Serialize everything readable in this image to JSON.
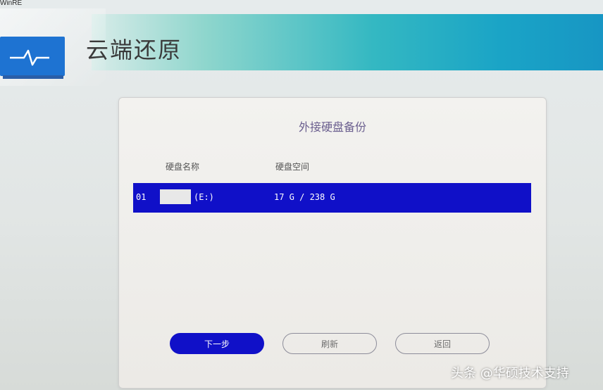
{
  "window": {
    "title": "WinRE"
  },
  "header": {
    "title": "云端还原"
  },
  "dialog": {
    "title": "外接硬盘备份",
    "columns": {
      "name": "硬盘名称",
      "space": "硬盘空间"
    },
    "rows": [
      {
        "index": "01",
        "drive": "(E:)",
        "space": "17 G / 238 G",
        "selected": true
      }
    ],
    "buttons": {
      "next": "下一步",
      "refresh": "刷新",
      "back": "返回"
    }
  },
  "watermark": "头条 @华硕技术支持",
  "colors": {
    "accent": "#1010c8",
    "header_gradient_start": "#d9ece9",
    "header_gradient_end": "#1796c4",
    "logo": "#1e73d2"
  }
}
